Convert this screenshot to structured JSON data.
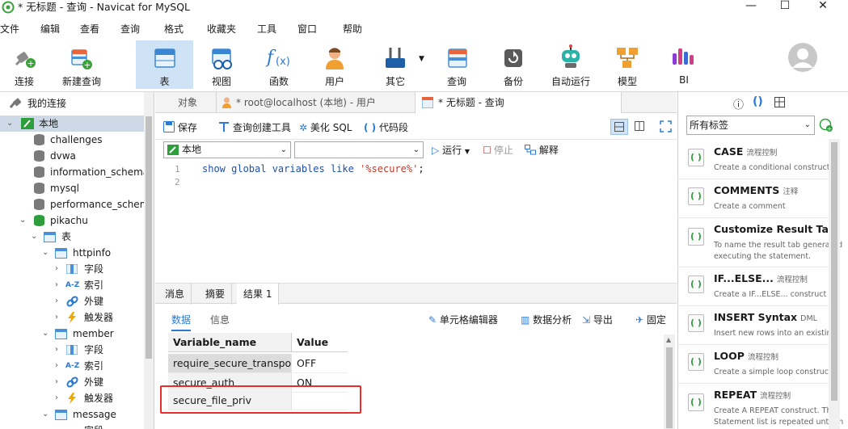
{
  "window": {
    "title": "* 无标题 - 查询 - Navicat for MySQL",
    "minimize": "—",
    "maximize": "☐",
    "close": "✕"
  },
  "menu": [
    "文件",
    "编辑",
    "查看",
    "查询",
    "格式",
    "收藏夹",
    "工具",
    "窗口",
    "帮助"
  ],
  "toolbar": {
    "connect": "连接",
    "new_query": "新建查询",
    "table": "表",
    "view": "视图",
    "function": "函数",
    "user": "用户",
    "other": "其它",
    "query": "查询",
    "backup": "备份",
    "auto_run": "自动运行",
    "model": "模型",
    "bi": "BI"
  },
  "tree": {
    "root": "我的连接",
    "connection": "本地",
    "databases": [
      "challenges",
      "dvwa",
      "information_schema",
      "mysql",
      "performance_schema"
    ],
    "open_db": "pikachu",
    "tables_label": "表",
    "tables": [
      {
        "name": "httpinfo",
        "children": [
          "字段",
          "索引",
          "外键",
          "触发器"
        ]
      },
      {
        "name": "member",
        "children": [
          "字段",
          "索引",
          "外键",
          "触发器"
        ]
      },
      {
        "name": "message",
        "children": [
          "字段"
        ]
      }
    ]
  },
  "tabs": {
    "objects": "对象",
    "user_tab": "* root@localhost (本地) - 用户",
    "query_tab": "* 无标题 - 查询"
  },
  "editor_toolbar": {
    "save": "保存",
    "query_builder": "查询创建工具",
    "beautify": "美化 SQL",
    "snippet": "代码段"
  },
  "run_bar": {
    "connection_value": "本地",
    "database_value": "",
    "run": "运行",
    "stop": "停止",
    "explain": "解释"
  },
  "editor": {
    "line_numbers": [
      "1",
      "2"
    ],
    "code_keyword": "show global variables like ",
    "code_string": "'%secure%'",
    "code_end": ";"
  },
  "result_tabs": {
    "messages": "消息",
    "summary": "摘要",
    "result1": "结果 1"
  },
  "result_bar": {
    "data": "数据",
    "info": "信息",
    "cell_editor": "单元格编辑器",
    "data_analysis": "数据分析",
    "export": "导出",
    "pin": "固定"
  },
  "grid": {
    "columns": [
      "Variable_name",
      "Value"
    ],
    "rows": [
      [
        "require_secure_transport",
        "OFF"
      ],
      [
        "secure_auth",
        "ON"
      ],
      [
        "secure_file_priv",
        ""
      ]
    ],
    "highlight_color": "#e5302a"
  },
  "right_panel": {
    "tag_filter": "所有标签",
    "snippets": [
      {
        "title": "CASE",
        "tag": "流程控制",
        "desc": [
          "Create a conditional construct"
        ]
      },
      {
        "title": "COMMENTS",
        "tag": "注释",
        "desc": [
          "Create a comment"
        ]
      },
      {
        "title": "Customize Result Tab",
        "tag": "",
        "desc": [
          "To name the result tab generated",
          "executing the statement."
        ]
      },
      {
        "title": "IF...ELSE...",
        "tag": "流程控制",
        "desc": [
          "Create a IF...ELSE... construct"
        ]
      },
      {
        "title": "INSERT Syntax",
        "tag": "DML",
        "desc": [
          "Insert new rows into an existing"
        ]
      },
      {
        "title": "LOOP",
        "tag": "流程控制",
        "desc": [
          "Create a simple loop construct"
        ]
      },
      {
        "title": "REPEAT",
        "tag": "流程控制",
        "desc": [
          "Create A REPEAT construct. The",
          "Statement list is repeated until th"
        ]
      }
    ]
  },
  "colors": {
    "accent": "#2a7ad5",
    "selection": "#cdd9e6",
    "toolbar_active": "#cfe3f7"
  }
}
